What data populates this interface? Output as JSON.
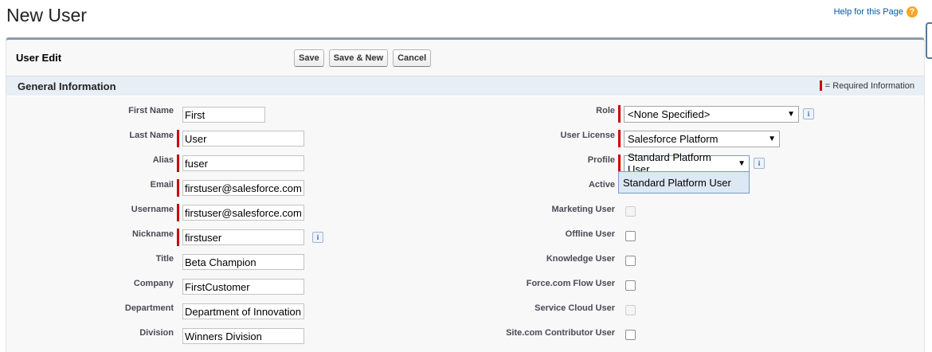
{
  "header": {
    "title": "New User",
    "help_link": "Help for this Page",
    "help_icon": "question-icon"
  },
  "block": {
    "title": "User Edit",
    "buttons": {
      "save": "Save",
      "save_new": "Save & New",
      "cancel": "Cancel"
    }
  },
  "section": {
    "title": "General Information",
    "required_legend": "= Required Information"
  },
  "left_fields": [
    {
      "label": "First Name",
      "value": "First",
      "required": false
    },
    {
      "label": "Last Name",
      "value": "User",
      "required": true
    },
    {
      "label": "Alias",
      "value": "fuser",
      "required": true
    },
    {
      "label": "Email",
      "value": "firstuser@salesforce.com",
      "required": true
    },
    {
      "label": "Username",
      "value": "firstuser@salesforce.com",
      "required": true
    },
    {
      "label": "Nickname",
      "value": "firstuser",
      "required": true
    },
    {
      "label": "Title",
      "value": "Beta Champion",
      "required": false
    },
    {
      "label": "Company",
      "value": "FirstCustomer",
      "required": false
    },
    {
      "label": "Department",
      "value": "Department of Innovation",
      "required": false
    },
    {
      "label": "Division",
      "value": "Winners Division",
      "required": false
    }
  ],
  "right_fields": {
    "role": {
      "label": "Role",
      "value": "<None Specified>"
    },
    "user_license": {
      "label": "User License",
      "value": "Salesforce Platform"
    },
    "profile": {
      "label": "Profile",
      "value": "Standard Platform User",
      "open_option": "Standard Platform User"
    },
    "active": {
      "label": "Active"
    },
    "marketing_user": {
      "label": "Marketing User",
      "disabled": true
    },
    "offline_user": {
      "label": "Offline User",
      "disabled": false
    },
    "knowledge_user": {
      "label": "Knowledge User",
      "disabled": false
    },
    "flow_user": {
      "label": "Force.com Flow User",
      "disabled": false
    },
    "service_cloud_user": {
      "label": "Service Cloud User",
      "disabled": true
    },
    "site_contributor_user": {
      "label": "Site.com Contributor User",
      "disabled": false
    }
  },
  "colors": {
    "required": "#cc0000",
    "section_bg": "#e8eef5",
    "link": "#015ba7"
  }
}
